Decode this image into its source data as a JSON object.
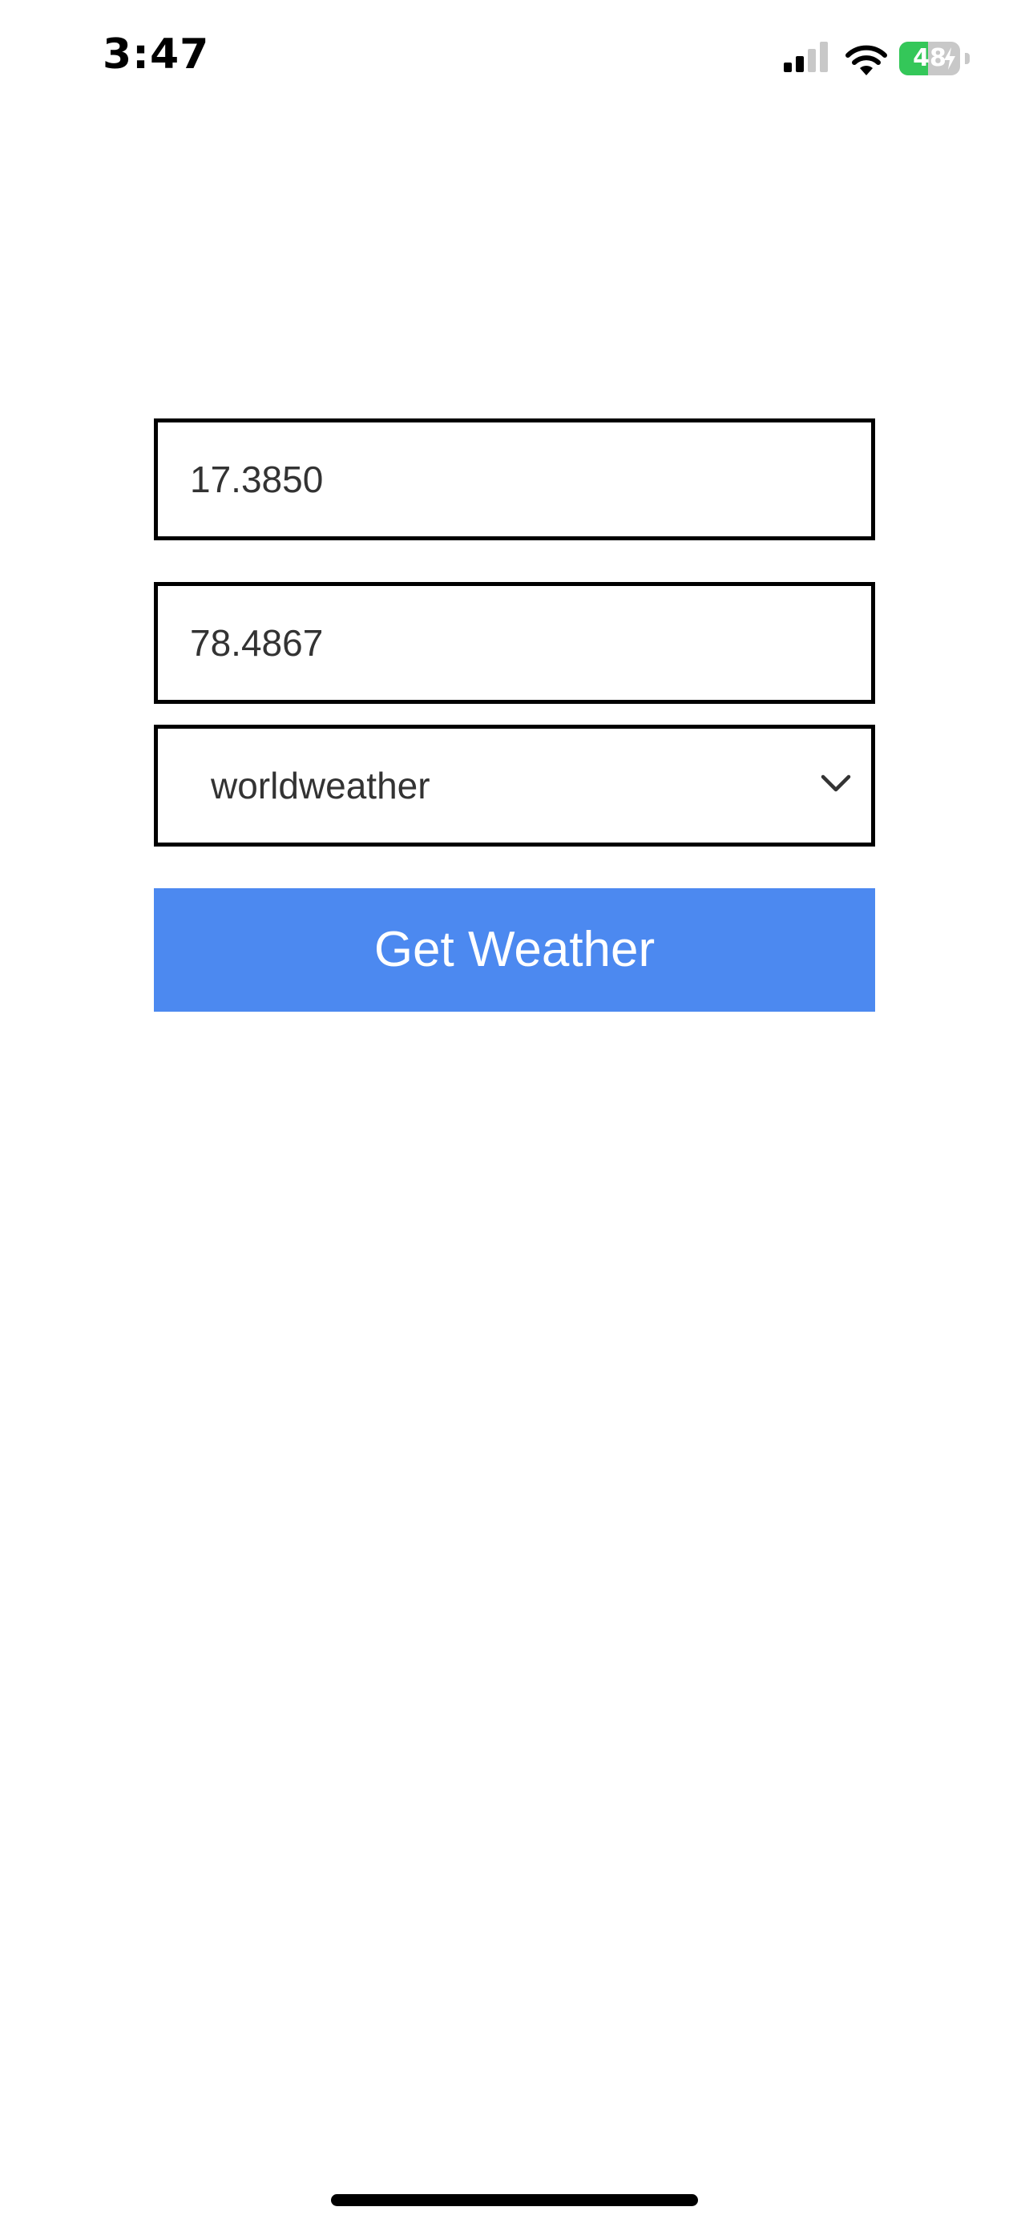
{
  "status_bar": {
    "time": "3:47",
    "battery_level": "48",
    "battery_percent": 48,
    "battery_charging": true,
    "signal_bars_filled": 2,
    "signal_bars_total": 4,
    "icons": [
      "cellular-signal-icon",
      "wifi-icon",
      "battery-icon",
      "charging-bolt-icon"
    ]
  },
  "form": {
    "latitude_value": "17.3850",
    "longitude_value": "78.4867",
    "provider_select": {
      "selected": "worldweather"
    },
    "submit_label": "Get Weather"
  },
  "colors": {
    "button_background": "#4c89f0",
    "button_text": "#ffffff",
    "field_border": "#000000",
    "battery_fill": "#34c759"
  }
}
